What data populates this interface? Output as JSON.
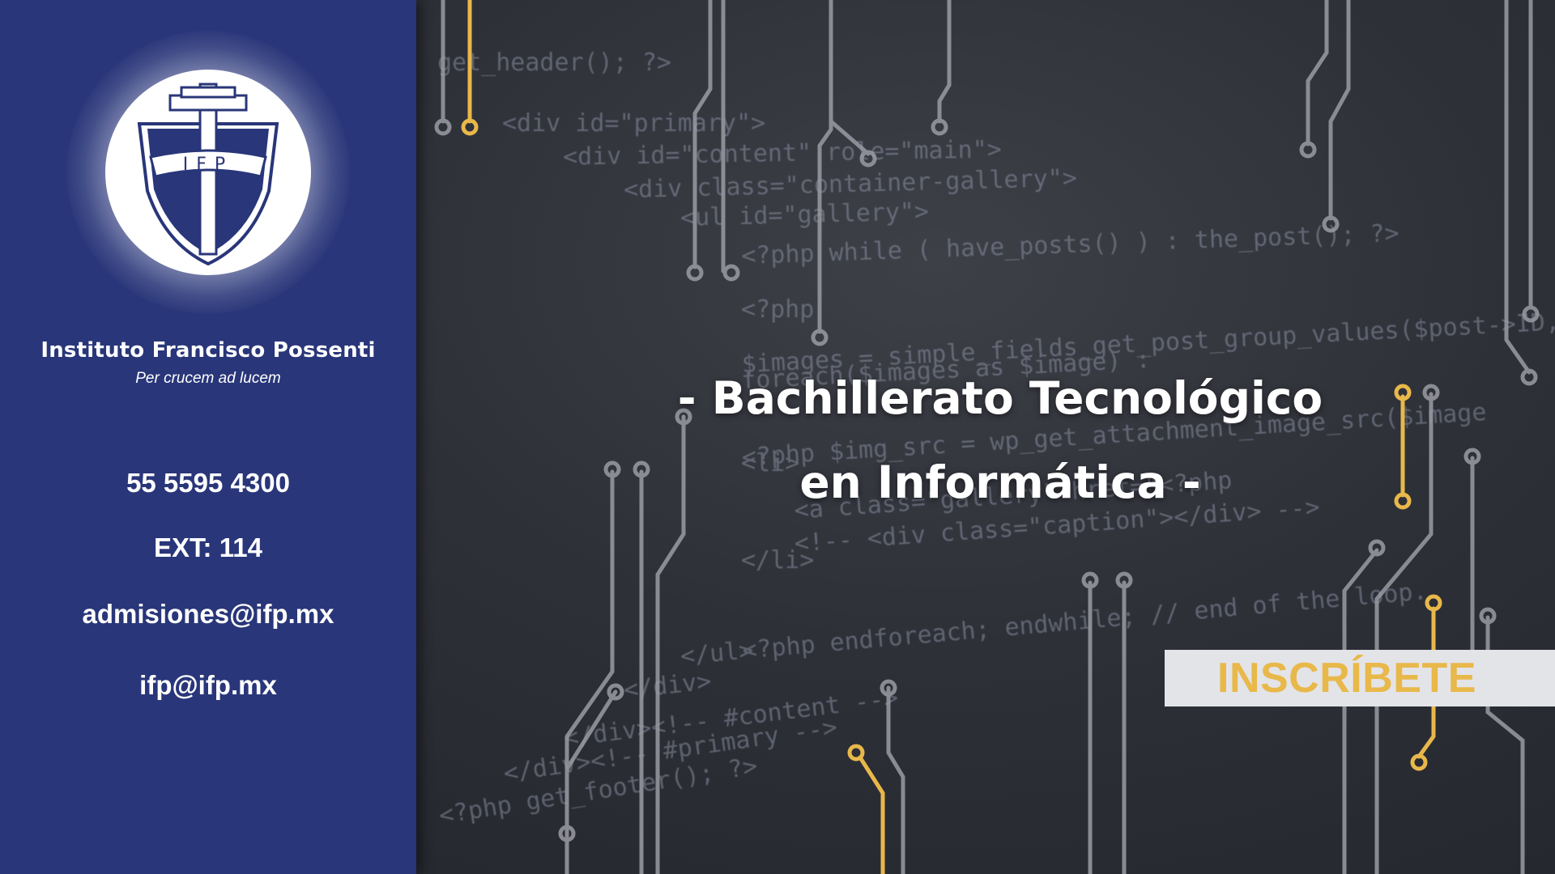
{
  "sidebar": {
    "logo_text": "IFP",
    "school_name": "Instituto Francisco Possenti",
    "motto": "Per crucem ad lucem",
    "phone": "55 5595 4300",
    "extension": "EXT: 114",
    "email_admissions": "admisiones@ifp.mx",
    "email_general": "ifp@ifp.mx",
    "icon": "shield-cross-icon"
  },
  "main": {
    "headline_line1": "- Bachillerato Tecnológico",
    "headline_line2": "en Informática -",
    "cta_label": "INSCRÍBETE"
  },
  "background_code": [
    "get_header(); ?>",
    "<div id=\"primary\">",
    "<div id=\"content\" role=\"main\">",
    "<div class=\"container-gallery\">",
    "<ul id=\"gallery\">",
    "<?php while ( have_posts() ) : the_post(); ?>",
    "<?php",
    "$images = simple_fields_get_post_group_values($post->ID, 'Gallery'",
    "foreach($images as $image) :",
    "<?php $img_src = wp_get_attachment_image_src($image",
    "<li>",
    "<a class=\"gallery\" href=\"<?php",
    "<!-- <div class=\"caption\"></div> -->",
    "</li>",
    "<?php endforeach; endwhile; // end of the loop.",
    "</ul>",
    "</div>",
    "</div><!-- #content -->",
    "</div><!-- #primary -->",
    "<?php get_footer(); ?>"
  ],
  "colors": {
    "sidebar_bg": "#293679",
    "accent_gold": "#e8b84a",
    "cta_bg": "#e3e4e8",
    "circuit_gray": "#9a9ca4",
    "page_bg": "#2b2d35"
  }
}
